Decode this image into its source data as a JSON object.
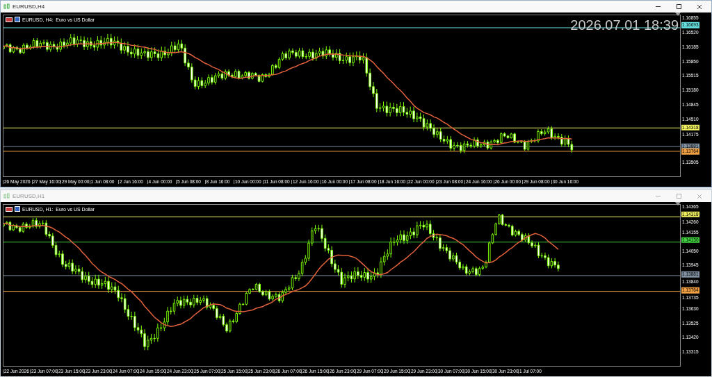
{
  "windows": [
    {
      "title": "EURUSD,H4",
      "active": true,
      "chart_label": "EURUSD, H4:  Euro vs US Dollar",
      "clock": "2026.07.01 18:39",
      "kind": "h4",
      "price_ticks": [
        "1.16855",
        "1.16520",
        "1.16185",
        "1.15850",
        "1.15515",
        "1.15180",
        "1.14845",
        "1.14510",
        "1.14175",
        "1.13505"
      ],
      "price_lines": [
        {
          "price": "1.16693",
          "color": "#66e0e0"
        },
        {
          "price": "1.14318",
          "color": "#f0f060"
        },
        {
          "price": "1.13881",
          "color": "#8090a0"
        },
        {
          "price": "1.13764",
          "color": "#f0a040"
        }
      ],
      "time_labels": [
        "26 May 2026",
        "27 May 16:00",
        "29 May 00:00",
        "1 Jun 08:00",
        "2 Jun 16:00",
        "4 Jun 00:00",
        "5 Jun 08:00",
        "8 Jun 16:00",
        "10 Jun 00:00",
        "11 Jun 08:00",
        "12 Jun 16:00",
        "16 Jun 00:00",
        "17 Jun 08:00",
        "18 Jun 16:00",
        "22 Jun 00:00",
        "23 Jun 08:00",
        "24 Jun 16:00",
        "26 Jun 00:00",
        "29 Jun 08:00",
        "30 Jun 16:00"
      ]
    },
    {
      "title": "EURUSD,H1",
      "active": false,
      "chart_label": "EURUSD, H1:  Euro vs US Dollar",
      "kind": "h1",
      "price_ticks": [
        "1.14365",
        "1.14260",
        "1.14155",
        "1.14050",
        "1.13945",
        "1.13840",
        "1.13735",
        "1.13630",
        "1.13525",
        "1.13420",
        "1.13315"
      ],
      "price_lines": [
        {
          "price": "1.14318",
          "color": "#f0f060"
        },
        {
          "price": "1.14130",
          "color": "#40d040"
        },
        {
          "price": "1.13881",
          "color": "#8090a0"
        },
        {
          "price": "1.13764",
          "color": "#f0a040"
        }
      ],
      "time_labels": [
        "22 Jun 2026",
        "23 Jun 07:00",
        "23 Jun 15:00",
        "23 Jun 23:00",
        "24 Jun 07:00",
        "24 Jun 15:00",
        "24 Jun 23:00",
        "25 Jun 07:00",
        "25 Jun 15:00",
        "25 Jun 23:00",
        "26 Jun 07:00",
        "26 Jun 15:00",
        "26 Jun 23:00",
        "29 Jun 07:00",
        "29 Jun 15:00",
        "29 Jun 23:00",
        "30 Jun 07:00",
        "30 Jun 15:00",
        "30 Jun 23:00",
        "1 Jul 07:00"
      ]
    }
  ]
}
